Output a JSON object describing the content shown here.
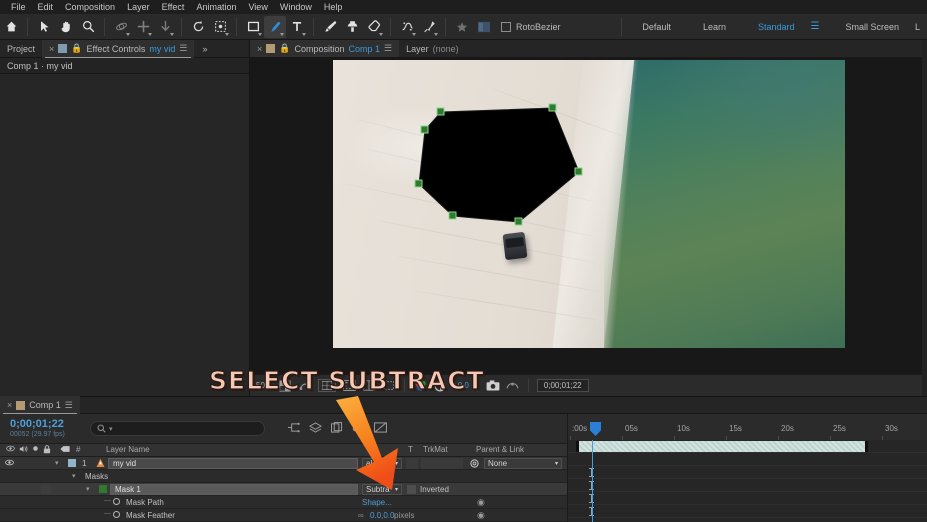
{
  "app": {
    "title": "Adobe After Effects"
  },
  "menubar": {
    "items": [
      "File",
      "Edit",
      "Composition",
      "Layer",
      "Effect",
      "Animation",
      "View",
      "Window",
      "Help"
    ]
  },
  "toolbar": {
    "tools": [
      {
        "name": "home-icon",
        "label": "Home"
      },
      {
        "name": "selection-tool-icon",
        "label": "Selection Tool"
      },
      {
        "name": "hand-tool-icon",
        "label": "Hand Tool"
      },
      {
        "name": "zoom-tool-icon",
        "label": "Zoom Tool"
      },
      {
        "name": "orbit-tool-icon",
        "label": "Orbit Tool"
      },
      {
        "name": "pan-tool-icon",
        "label": "Pan Behind Tool"
      },
      {
        "name": "dolly-tool-icon",
        "label": "Dolly Tool"
      },
      {
        "name": "rotation-tool-icon",
        "label": "Rotation Tool"
      },
      {
        "name": "roto-brush-tool-icon",
        "label": "Roto Brush Tool"
      },
      {
        "name": "shape-tool-icon",
        "label": "Rectangle Tool"
      },
      {
        "name": "pen-tool-icon",
        "label": "Pen Tool"
      },
      {
        "name": "type-tool-icon",
        "label": "Type Tool"
      },
      {
        "name": "brush-tool-icon",
        "label": "Brush Tool"
      },
      {
        "name": "clone-stamp-tool-icon",
        "label": "Clone Stamp Tool"
      },
      {
        "name": "eraser-tool-icon",
        "label": "Eraser Tool"
      },
      {
        "name": "refine-edge-tool-icon",
        "label": "Refine Edge Tool"
      },
      {
        "name": "puppet-pin-tool-icon",
        "label": "Puppet Pin Tool"
      }
    ],
    "rotobezier_label": "RotoBezier",
    "rotobezier_checked": false,
    "workspaces": [
      "Default",
      "Learn",
      "Standard",
      "Small Screen"
    ],
    "workspace_selected": "Standard",
    "workspace_cutoff": "L"
  },
  "left_panel": {
    "tabs": [
      {
        "label": "Project",
        "selected": false,
        "has_close": false
      },
      {
        "label": "Effect Controls",
        "suffix": "my vid",
        "selected": true,
        "has_close": true
      }
    ],
    "overflow_icon": "chevron-double-right-icon",
    "header": "Comp 1 · my vid"
  },
  "comp_panel": {
    "tabs": [
      {
        "label": "Composition",
        "suffix": "Comp 1",
        "selected": true,
        "has_close": true
      }
    ],
    "layer_label": "Layer",
    "layer_value": "(none)",
    "subtab": "Comp 1",
    "bottom_bar": {
      "magnification": "50%",
      "timecode": "0;00;01;22",
      "exposure": "+0.0",
      "icons": [
        "toggle-transparency-grid-icon",
        "toggle-mask-paths-icon",
        "title-action-safe-icon",
        "toggle-view-layout-icon",
        "channel-rgb-icon",
        "exposure-icon",
        "snapshot-icon",
        "show-snapshot-icon"
      ]
    },
    "mask": {
      "name": "Mask 1",
      "vertex_count": 7,
      "fill": "#000000",
      "handle_color": "#2f7a2f"
    }
  },
  "timeline": {
    "tabs": [
      {
        "label": "Comp 1",
        "selected": true,
        "has_close": true
      }
    ],
    "current_time": "0;00;01;22",
    "frame_info": "00052 (29.97 fps)",
    "search_placeholder": "",
    "toolbar_icons": [
      "composition-mini-flowchart-icon",
      "draft-3d-icon",
      "hide-shy-layers-icon",
      "frame-blending-icon",
      "motion-blur-icon",
      "graph-editor-icon"
    ],
    "columns": [
      "Layer Name",
      "T",
      "TrkMat",
      "Parent & Link"
    ],
    "switch_icons": [
      "video-switch-icon",
      "audio-switch-icon",
      "solo-switch-icon",
      "lock-switch-icon",
      "label-icon",
      "index-icon"
    ],
    "ruler_labels": [
      ":00s",
      "05s",
      "10s",
      "15s",
      "20s",
      "25s",
      "30s"
    ],
    "rows": [
      {
        "type": "layer",
        "index": "1",
        "name": "my vid",
        "label_color": "#8fb6c6",
        "source_icon": "video-source-icon",
        "mode": "Normal",
        "mode_display": "al",
        "trkmat": "",
        "parent": "None",
        "parent_icon": "pickwhip-icon"
      },
      {
        "type": "group",
        "name": "Masks",
        "indent": 1
      },
      {
        "type": "mask",
        "name": "Mask 1",
        "indent": 2,
        "mode": "Subtract",
        "mode_display": "Subtra",
        "inverted_label": "Inverted",
        "inverted": false,
        "swatch_color": "#2f7a2f"
      },
      {
        "type": "property",
        "name": "Mask Path",
        "indent": 3,
        "value": "Shape...",
        "value_is_link": true
      },
      {
        "type": "property",
        "name": "Mask Feather",
        "indent": 3,
        "value": "0.0,0.0",
        "unit": "pixels",
        "linked": true
      }
    ]
  },
  "annotation": {
    "text": "SELECT SUBTRACT",
    "text_color": "#f7c9b4",
    "arrow_color_top": "#fcb040",
    "arrow_color_bottom": "#f04e18"
  }
}
